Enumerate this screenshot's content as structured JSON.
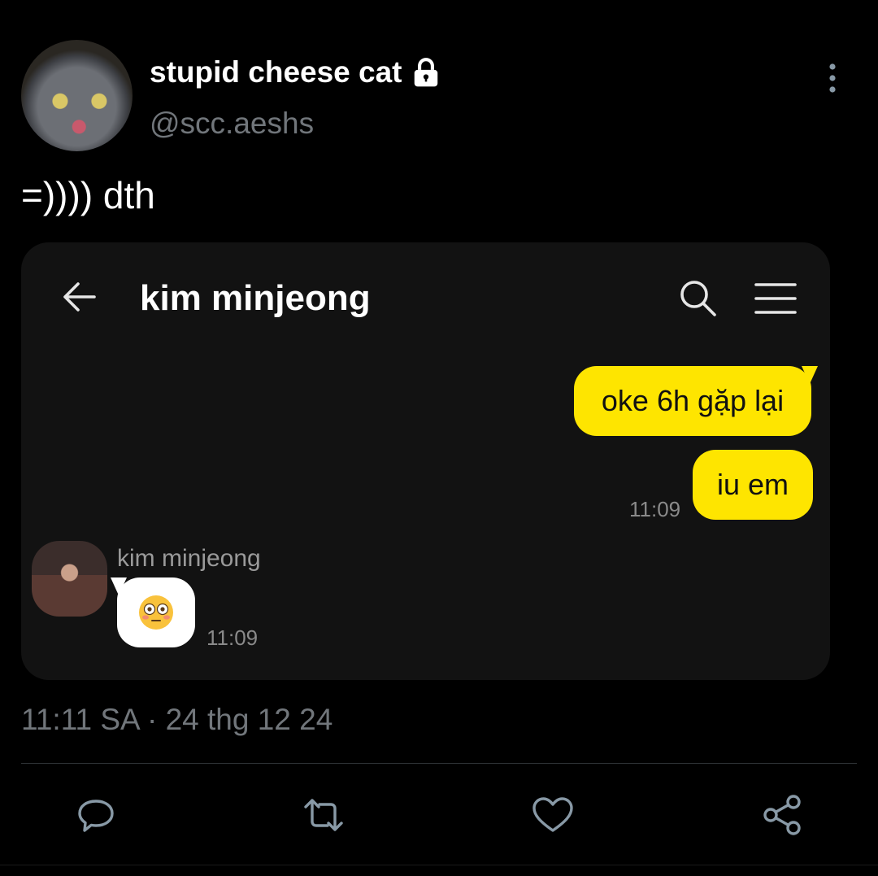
{
  "tweet": {
    "display_name": "stupid cheese cat",
    "handle": "@scc.aeshs",
    "text": "=)))) dth",
    "timestamp": "11:11 SA · 24 thg 12 24"
  },
  "chat": {
    "title": "kim minjeong",
    "messages_sent": [
      {
        "text": "oke 6h gặp lại"
      },
      {
        "text": "iu em",
        "time": "11:09"
      }
    ],
    "received": {
      "sender": "kim minjeong",
      "emoji": "😳",
      "time": "11:09"
    }
  },
  "colors": {
    "background": "#000000",
    "chat_background": "#121212",
    "sent_bubble": "#fee500",
    "muted_text": "#71767b"
  },
  "icons": [
    "lock-icon",
    "more-vertical-icon",
    "back-arrow-icon",
    "search-icon",
    "menu-icon",
    "reply-icon",
    "retweet-icon",
    "like-icon",
    "share-icon"
  ]
}
